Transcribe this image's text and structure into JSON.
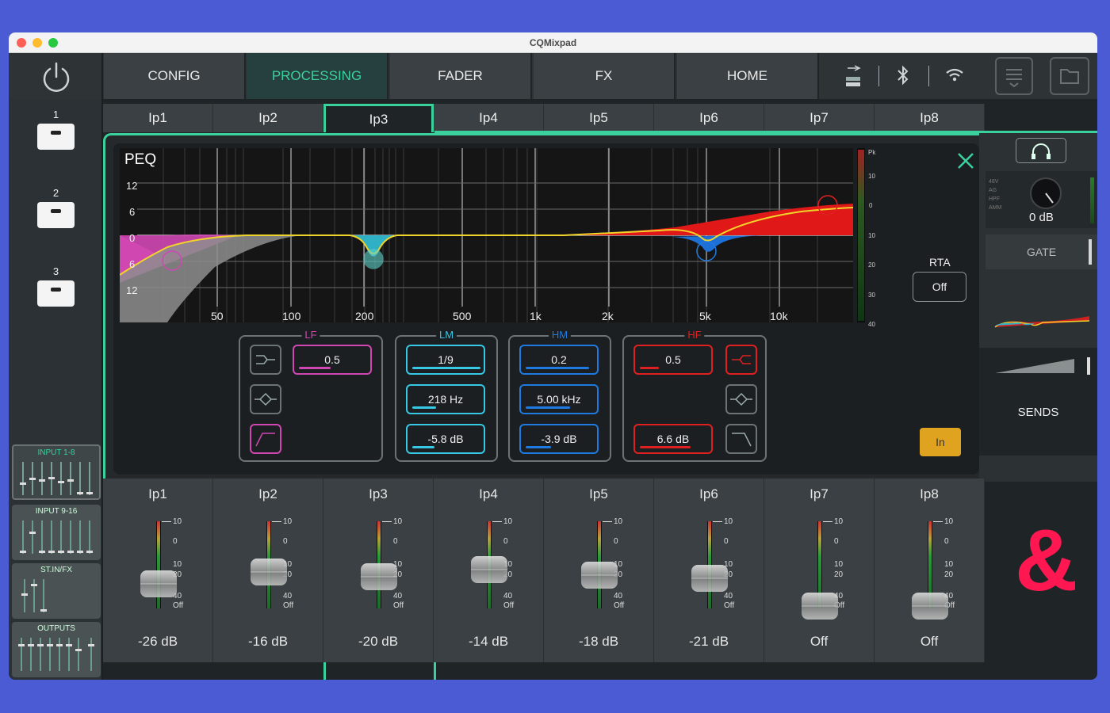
{
  "window": {
    "title": "CQMixpad"
  },
  "nav": {
    "tabs": [
      "CONFIG",
      "PROCESSING",
      "FADER",
      "FX",
      "HOME"
    ],
    "active": "PROCESSING"
  },
  "sidebar": {
    "slots": [
      "1",
      "2",
      "3"
    ],
    "banks": [
      "INPUT 1-8",
      "INPUT 9-16",
      "ST.IN/FX",
      "OUTPUTS"
    ]
  },
  "channel_tabs": [
    "Ip1",
    "Ip2",
    "Ip3",
    "Ip4",
    "Ip5",
    "Ip6",
    "Ip7",
    "Ip8"
  ],
  "peq": {
    "title": "PEQ",
    "y_ticks": [
      "12",
      "6",
      "0",
      "6",
      "12"
    ],
    "freq_ticks": [
      "50",
      "100",
      "200",
      "500",
      "1k",
      "2k",
      "5k",
      "10k"
    ],
    "meter_ticks": [
      "Pk",
      "10",
      "0",
      "10",
      "20",
      "30",
      "40"
    ],
    "rta_label": "RTA",
    "rta_value": "Off",
    "in_label": "In",
    "bands": {
      "lf": {
        "label": "LF",
        "width": "0.5",
        "color": "#d63aa8"
      },
      "lm": {
        "label": "LM",
        "width": "1/9",
        "freq": "218 Hz",
        "gain": "-5.8 dB",
        "color": "#37c8e6"
      },
      "hm": {
        "label": "HM",
        "width": "0.2",
        "freq": "5.00 kHz",
        "gain": "-3.9 dB",
        "color": "#1e7ae0"
      },
      "hf": {
        "label": "HF",
        "width": "0.5",
        "gain": "6.6 dB",
        "color": "#e02020"
      }
    }
  },
  "right_panel": {
    "gain": "0 dB",
    "badges": [
      "48V",
      "AG",
      "HPF",
      "AMM"
    ],
    "gate": "GATE",
    "sends": "SENDS"
  },
  "faders": {
    "scale": [
      "10",
      "0",
      "10",
      "20",
      "40",
      "Off"
    ],
    "channels": [
      {
        "name": "Ip1",
        "value": "-26 dB",
        "level": 0.35
      },
      {
        "name": "Ip2",
        "value": "-16 dB",
        "level": 0.52
      },
      {
        "name": "Ip3",
        "value": "-20 dB",
        "level": 0.45
      },
      {
        "name": "Ip4",
        "value": "-14 dB",
        "level": 0.56
      },
      {
        "name": "Ip5",
        "value": "-18 dB",
        "level": 0.48
      },
      {
        "name": "Ip6",
        "value": "-21 dB",
        "level": 0.43
      },
      {
        "name": "Ip7",
        "value": "Off",
        "level": 0.02
      },
      {
        "name": "Ip8",
        "value": "Off",
        "level": 0.02
      }
    ]
  },
  "logo": {
    "text": "&"
  }
}
